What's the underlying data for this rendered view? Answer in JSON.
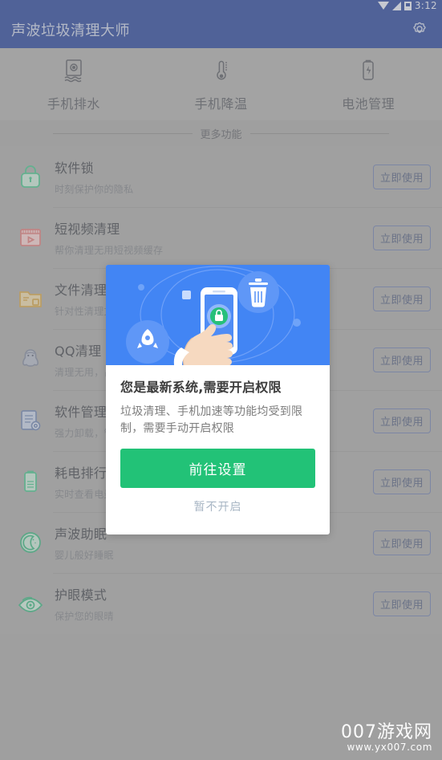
{
  "statusbar": {
    "time": "3:12",
    "icons": [
      "wifi-icon",
      "signal-icon",
      "battery-icon"
    ]
  },
  "header": {
    "title": "声波垃圾清理大师",
    "settings_icon": "gear-icon"
  },
  "tabs": [
    {
      "label": "手机排水",
      "icon": "water-eject-icon"
    },
    {
      "label": "手机降温",
      "icon": "thermometer-icon"
    },
    {
      "label": "电池管理",
      "icon": "battery-bolt-icon"
    }
  ],
  "section": {
    "label": "更多功能"
  },
  "list": {
    "action_label": "立即使用",
    "items": [
      {
        "title": "软件锁",
        "sub": "时刻保护你的隐私",
        "icon": "lock-icon",
        "color": "#5cc99a"
      },
      {
        "title": "短视频清理",
        "sub": "帮你清理无用短视频缓存",
        "icon": "video-icon",
        "color": "#e08a8a"
      },
      {
        "title": "文件清理",
        "sub": "针对性清理文件",
        "icon": "folder-icon",
        "color": "#d8ae5c"
      },
      {
        "title": "QQ清理",
        "sub": "清理无用，占用空间",
        "icon": "qq-penguin-icon",
        "color": "#8f96a8"
      },
      {
        "title": "软件管理",
        "sub": "强力卸载，管理应用",
        "icon": "app-manage-icon",
        "color": "#7f93bb"
      },
      {
        "title": "耗电排行",
        "sub": "实时查看电量消耗",
        "icon": "battery-rank-icon",
        "color": "#5cc99a"
      },
      {
        "title": "声波助眠",
        "sub": "婴儿般好睡眠",
        "icon": "moon-icon",
        "color": "#4fbd8e"
      },
      {
        "title": "护眼模式",
        "sub": "保护您的眼晴",
        "icon": "eye-icon",
        "color": "#4fbd8e"
      }
    ]
  },
  "dialog": {
    "illustration": "hand-holding-phone-lock-illustration",
    "title": "您是最新系统,需要开启权限",
    "message": "垃圾清理、手机加速等功能均受到限制，需要手动开启权限",
    "primary_label": "前往设置",
    "secondary_label": "暂不开启",
    "primary_color": "#22c277",
    "hero_color": "#4285f4"
  },
  "watermark": {
    "main": "007游戏网",
    "sub": "www.yx007.com"
  }
}
